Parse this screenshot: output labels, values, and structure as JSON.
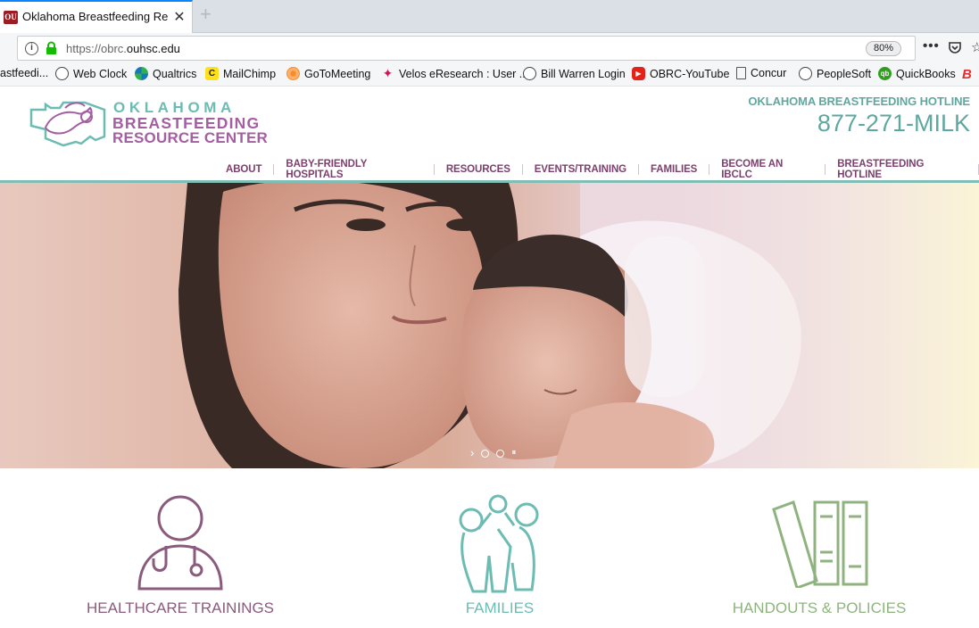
{
  "browser": {
    "tab_title": "Oklahoma Breastfeeding Resea",
    "url_prefix": "https://obrc.",
    "url_domain": "ouhsc.edu",
    "zoom": "80%"
  },
  "bookmarks": [
    {
      "label": "astfeedi...",
      "icon": "page-icon"
    },
    {
      "label": "Web Clock",
      "icon": "globe-icon"
    },
    {
      "label": "Qualtrics",
      "icon": "qualtrics-icon"
    },
    {
      "label": "MailChimp",
      "icon": "mailchimp-icon"
    },
    {
      "label": "GoToMeeting",
      "icon": "gotomeeting-icon"
    },
    {
      "label": "Velos eResearch : User ...",
      "icon": "velos-icon"
    },
    {
      "label": "Bill Warren Login",
      "icon": "globe-icon"
    },
    {
      "label": "OBRC-YouTube",
      "icon": "youtube-icon"
    },
    {
      "label": "Concur",
      "icon": "page-icon"
    },
    {
      "label": "PeopleSoft",
      "icon": "globe-icon"
    },
    {
      "label": "QuickBooks",
      "icon": "quickbooks-icon"
    }
  ],
  "site": {
    "logo_line1": "OKLAHOMA",
    "logo_line2": "BREASTFEEDING",
    "logo_line3": "RESOURCE CENTER",
    "hotline_label": "OKLAHOMA BREASTFEEDING HOTLINE",
    "hotline_number": "877-271-MILK",
    "nav": [
      "ABOUT",
      "BABY-FRIENDLY HOSPITALS",
      "RESOURCES",
      "EVENTS/TRAINING",
      "FAMILIES",
      "BECOME AN IBCLC",
      "BREASTFEEDING HOTLINE"
    ],
    "colors": {
      "teal": "#5fa8a0",
      "purple": "#7d3f6e",
      "green": "#8fb37f",
      "mauve": "#8a5b7c"
    }
  },
  "features": [
    {
      "label": "HEALTHCARE TRAININGS",
      "icon": "doctor-icon",
      "color": "#8a5b7c"
    },
    {
      "label": "FAMILIES",
      "icon": "family-icon",
      "color": "#6cbcb3"
    },
    {
      "label": "HANDOUTS & POLICIES",
      "icon": "binders-icon",
      "color": "#8fb37f"
    }
  ]
}
